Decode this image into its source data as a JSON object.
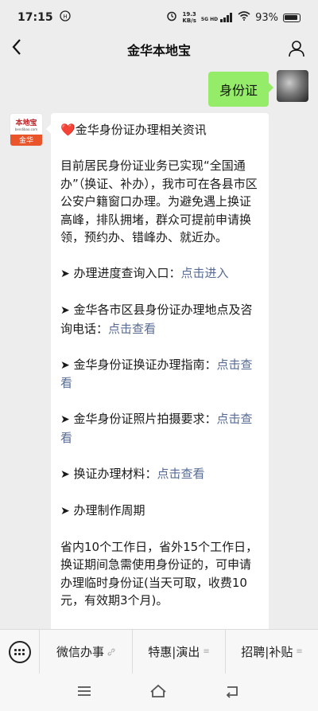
{
  "status_bar": {
    "time": "17:15",
    "net_speed_value": "19.3",
    "net_speed_unit": "KB/s",
    "signal": "5G HD",
    "battery": "93%"
  },
  "nav": {
    "title": "金华本地宝"
  },
  "my_message": {
    "text": "身份证"
  },
  "bot": {
    "avatar_logo": "本地宝",
    "avatar_domain": "bendibao.com",
    "avatar_city": "金华",
    "title_emoji": "❤️",
    "title": "金华身份证办理相关资讯",
    "intro": "目前居民身份证业务已实现“全国通办”（换证、补办），我市可在各县市区公安户籍窗口办理。为避免遇上换证高峰，排队拥堵，群众可提前申请换领，预约办、错峰办、就近办。",
    "items": [
      {
        "text": "办理进度查询入口：",
        "link": "点击进入"
      },
      {
        "text": "金华各市区县身份证办理地点及咨询电话：",
        "link": "点击查看"
      },
      {
        "text": "金华身份证换证办理指南：",
        "link": "点击查看"
      },
      {
        "text": "金华身份证照片拍摄要求：",
        "link": "点击查看"
      },
      {
        "text": "换证办理材料：",
        "link": "点击查看"
      },
      {
        "text": "办理制作周期",
        "link": ""
      }
    ],
    "arrow": "➤",
    "cycle_text": "省内10个工作日，省外15个工作日，换证期间急需使用身份证的，可申请办理临时身份证(当天可取，收费10元，有效期3个月)。"
  },
  "bottom_menu": {
    "items": [
      {
        "label": "微信办事"
      },
      {
        "label": "特惠|演出"
      },
      {
        "label": "招聘|补贴"
      }
    ]
  },
  "colors": {
    "my_bubble": "#95ec69",
    "link": "#576b95",
    "background": "#ededed"
  }
}
